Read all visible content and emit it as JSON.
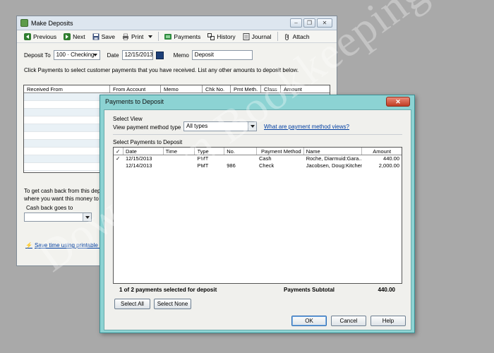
{
  "make_deposits": {
    "title": "Make Deposits",
    "toolbar": {
      "previous": "Previous",
      "next": "Next",
      "save": "Save",
      "print": "Print",
      "payments": "Payments",
      "history": "History",
      "journal": "Journal",
      "attach": "Attach"
    },
    "deposit_to_label": "Deposit To",
    "deposit_to_value": "100 · Checking",
    "date_label": "Date",
    "date_value": "12/15/2013",
    "memo_label": "Memo",
    "memo_value": "Deposit",
    "instructions": "Click Payments to select customer payments that you have received. List any other amounts to deposit below.",
    "columns": [
      "Received From",
      "From Account",
      "Memo",
      "Chk No.",
      "Pmt Meth.",
      "Class",
      "Amount"
    ],
    "cash_back_text_1": "To get cash back from this deposi",
    "cash_back_text_2": "where you want this money to g",
    "cash_back_label": "Cash back goes to",
    "save_time_link": "Save time using printable or p"
  },
  "payments_to_deposit": {
    "title": "Payments to Deposit",
    "select_view_label": "Select View",
    "view_type_label": "View payment method type",
    "view_type_value": "All types",
    "what_link": "What are payment method views?",
    "select_payments_label": "Select Payments to Deposit",
    "columns": {
      "check": "✓",
      "date": "Date",
      "time": "Time",
      "type": "Type",
      "no": "No.",
      "payment_method": "Payment Method",
      "name": "Name",
      "amount": "Amount"
    },
    "rows": [
      {
        "check": "✓",
        "date": "12/15/2013",
        "time": "",
        "type": "PMT",
        "no": "",
        "payment_method": "Cash",
        "name": "Roche, Diarmuid:Gara...",
        "amount": "440.00"
      },
      {
        "check": "",
        "date": "12/14/2013",
        "time": "",
        "type": "PMT",
        "no": "986",
        "payment_method": "Check",
        "name": "Jacobsen, Doug:Kitchen",
        "amount": "2,000.00"
      }
    ],
    "selected_summary": "1 of 2 payments selected for deposit",
    "subtotal_label": "Payments Subtotal",
    "subtotal_value": "440.00",
    "buttons": {
      "select_all": "Select All",
      "select_none": "Select None",
      "ok": "OK",
      "cancel": "Cancel",
      "help": "Help"
    }
  },
  "watermark": "Downtown Bookkeeping"
}
